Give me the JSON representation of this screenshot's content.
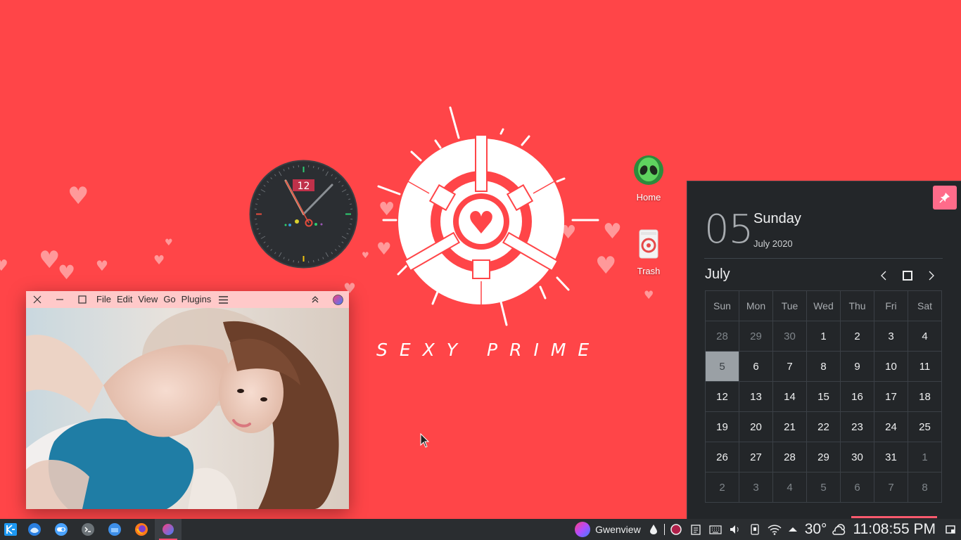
{
  "wallpaper": {
    "title": "SEXY PRIME"
  },
  "clock_widget": {
    "date_badge": "12"
  },
  "desktop_icons": [
    {
      "label": "Home",
      "icon": "alien-home-icon"
    },
    {
      "label": "Trash",
      "icon": "trash-icon"
    }
  ],
  "gwenview": {
    "menu": [
      "File",
      "Edit",
      "View",
      "Go",
      "Plugins"
    ]
  },
  "calendar": {
    "day_number": "05",
    "weekday": "Sunday",
    "month_year": "July 2020",
    "month_title": "July",
    "weekdays": [
      "Sun",
      "Mon",
      "Tue",
      "Wed",
      "Thu",
      "Fri",
      "Sat"
    ],
    "weeks": [
      [
        "28",
        "29",
        "30",
        "1",
        "2",
        "3",
        "4"
      ],
      [
        "5",
        "6",
        "7",
        "8",
        "9",
        "10",
        "11"
      ],
      [
        "12",
        "13",
        "14",
        "15",
        "16",
        "17",
        "18"
      ],
      [
        "19",
        "20",
        "21",
        "22",
        "23",
        "24",
        "25"
      ],
      [
        "26",
        "27",
        "28",
        "29",
        "30",
        "31",
        "1"
      ],
      [
        "2",
        "3",
        "4",
        "5",
        "6",
        "7",
        "8"
      ]
    ],
    "today": "5"
  },
  "taskbar": {
    "active_app_label": "Gwenview",
    "temperature": "30°",
    "time": "11:08:55 PM",
    "launchers": [
      "kde-menu-icon",
      "thunderbird-icon",
      "toggle-icon",
      "terminal-icon",
      "file-manager-icon",
      "firefox-icon",
      "gwenview-icon"
    ],
    "accent": "#ff4a6e"
  }
}
